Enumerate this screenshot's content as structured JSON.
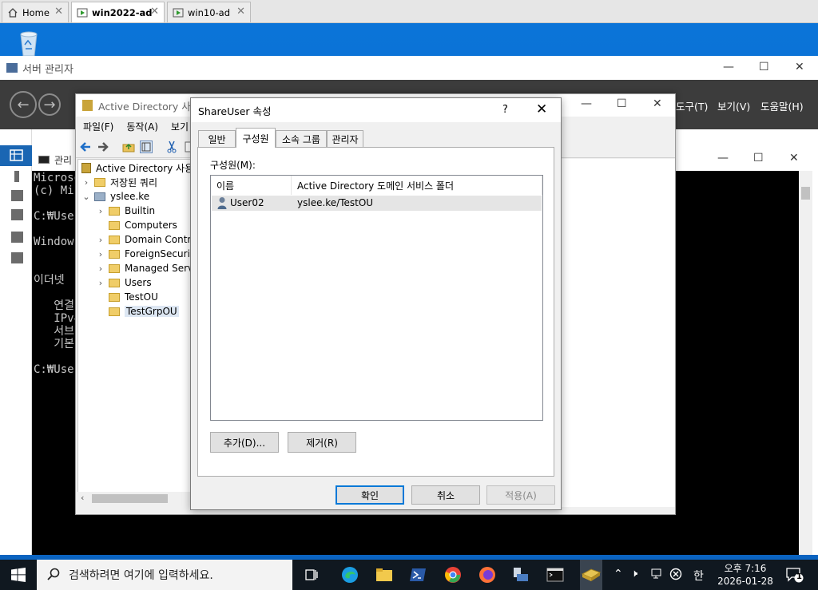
{
  "browser_tabs": [
    {
      "label": "Home"
    },
    {
      "label": "win2022-ad"
    },
    {
      "label": "win10-ad"
    }
  ],
  "server_manager": {
    "title": "서버 관리자",
    "menu": [
      "도구(T)",
      "보기(V)",
      "도움말(H)"
    ]
  },
  "cmd": {
    "title": "관리",
    "lines": [
      "Microso",
      "(c) Mic",
      "",
      "C:₩User",
      "",
      "Windows",
      "",
      "",
      "이더넷 ",
      "",
      "   연결",
      "   IPv4",
      "   서브",
      "   기본",
      "",
      "C:₩User"
    ]
  },
  "aduc": {
    "title": "Active Directory 사용자",
    "menu": [
      "파일(F)",
      "동작(A)",
      "보기"
    ],
    "tree": {
      "root": "Active Directory 사용자",
      "saved_queries": "저장된 쿼리",
      "domain": "yslee.ke",
      "items": [
        {
          "label": "Builtin",
          "expandable": true
        },
        {
          "label": "Computers",
          "expandable": false
        },
        {
          "label": "Domain Contro",
          "expandable": true
        },
        {
          "label": "ForeignSecurity",
          "expandable": true
        },
        {
          "label": "Managed Servi",
          "expandable": true
        },
        {
          "label": "Users",
          "expandable": true
        },
        {
          "label": "TestOU",
          "expandable": false
        },
        {
          "label": "TestGrpOU",
          "expandable": false,
          "selected": true
        }
      ]
    }
  },
  "dialog": {
    "title": "ShareUser 속성",
    "help": "?",
    "tabs": [
      {
        "label": "일반",
        "active": false
      },
      {
        "label": "구성원",
        "active": true
      },
      {
        "label": "소속 그룹",
        "active": false
      },
      {
        "label": "관리자",
        "active": false
      }
    ],
    "members_label": "구성원(M):",
    "columns": [
      "이름",
      "Active Directory 도메인 서비스 폴더"
    ],
    "members": [
      {
        "name": "User02",
        "folder": "yslee.ke/TestOU"
      }
    ],
    "add_label": "추가(D)...",
    "remove_label": "제거(R)",
    "ok_label": "확인",
    "cancel_label": "취소",
    "apply_label": "적용(A)"
  },
  "taskbar": {
    "search_placeholder": "검색하려면 여기에 입력하세요.",
    "ime": "한",
    "time": "오후 7:16",
    "date": "2026-01-28",
    "notification_count": "1"
  },
  "colors": {
    "accent": "#0078d7",
    "desktop": "#0b74d8",
    "taskbar": "#101820"
  }
}
